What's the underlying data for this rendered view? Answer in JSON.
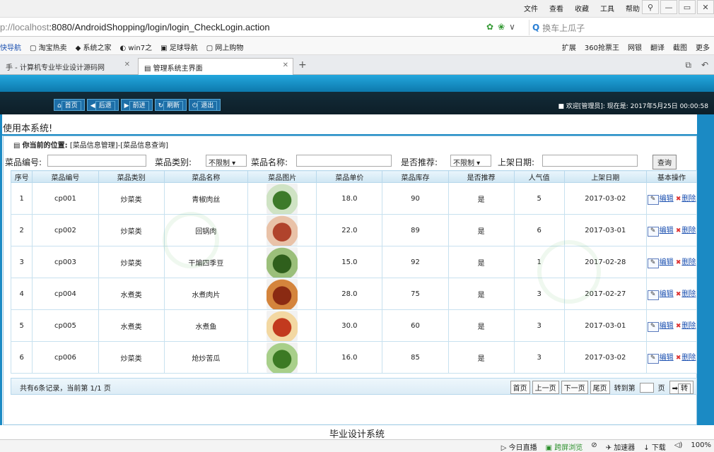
{
  "browser": {
    "menus": [
      "文件",
      "查看",
      "收藏",
      "工具",
      "帮助"
    ],
    "url_host": "p://localhost",
    "url_rest": ":8080/AndroidShopping/login/login_CheckLogin.action",
    "search_placeholder": "换车上瓜子",
    "bookmarks": [
      "快导航",
      "淘宝热卖",
      "系统之家",
      "win7之",
      "足球导航",
      "网上购物"
    ],
    "toolbar_right": [
      "扩展",
      "360抢票王",
      "网银",
      "翻译",
      "截图",
      "更多"
    ],
    "tab1": "手 - 计算机专业毕业设计源码网",
    "tab2": "管理系统主界面"
  },
  "app": {
    "nav": [
      "首页",
      "后退",
      "前进",
      "刷新",
      "退出"
    ],
    "welcome": "欢迎[管理员]:  现在是: 2017年5月25日  00:00:58",
    "notice": "使用本系统!",
    "position_label": "你当前的位置:",
    "position_path": "[菜品信息管理]-[菜品信息查询]"
  },
  "filters": {
    "code_label": "菜品编号:",
    "type_label": "菜品类别:",
    "type_value": "不限制",
    "name_label": "菜品名称:",
    "rec_label": "是否推荐:",
    "rec_value": "不限制",
    "date_label": "上架日期:",
    "query": "查询"
  },
  "table": {
    "headers": [
      "序号",
      "菜品编号",
      "菜品类别",
      "菜品名称",
      "菜品图片",
      "菜品单价",
      "菜品库存",
      "是否推荐",
      "人气值",
      "上架日期",
      "基本操作"
    ],
    "rows": [
      {
        "no": "1",
        "code": "cp001",
        "type": "炒菜类",
        "name": "青椒肉丝",
        "price": "18.0",
        "stock": "90",
        "rec": "是",
        "pop": "5",
        "date": "2017-03-02",
        "c1": "#cfe3c4",
        "c2": "#3d7a2a"
      },
      {
        "no": "2",
        "code": "cp002",
        "type": "炒菜类",
        "name": "回锅肉",
        "price": "22.0",
        "stock": "89",
        "rec": "是",
        "pop": "6",
        "date": "2017-03-01",
        "c1": "#e9c2a8",
        "c2": "#b0432c"
      },
      {
        "no": "3",
        "code": "cp003",
        "type": "炒菜类",
        "name": "干煸四季豆",
        "price": "15.0",
        "stock": "92",
        "rec": "是",
        "pop": "1",
        "date": "2017-02-28",
        "c1": "#9bbf7a",
        "c2": "#2f5f1c"
      },
      {
        "no": "4",
        "code": "cp004",
        "type": "水煮类",
        "name": "水煮肉片",
        "price": "28.0",
        "stock": "75",
        "rec": "是",
        "pop": "3",
        "date": "2017-02-27",
        "c1": "#d4843c",
        "c2": "#8a2a12"
      },
      {
        "no": "5",
        "code": "cp005",
        "type": "水煮类",
        "name": "水煮鱼",
        "price": "30.0",
        "stock": "60",
        "rec": "是",
        "pop": "3",
        "date": "2017-03-01",
        "c1": "#f3d8a2",
        "c2": "#c23a1e"
      },
      {
        "no": "6",
        "code": "cp006",
        "type": "炒菜类",
        "name": "炝炒苦瓜",
        "price": "16.0",
        "stock": "85",
        "rec": "是",
        "pop": "3",
        "date": "2017-03-02",
        "c1": "#a8cf8a",
        "c2": "#3c7a24"
      }
    ],
    "edit": "编辑",
    "delete": "删除"
  },
  "pager": {
    "total": "共有6条记录，当前第 1/1 页",
    "first": "首页",
    "prev": "上一页",
    "next": "下一页",
    "last": "尾页",
    "goto": "转到第",
    "page": "页",
    "go": "转"
  },
  "footer": "毕业设计系统",
  "status": {
    "items": [
      "今日直播",
      "跨屏浏览",
      "加速器",
      "下载"
    ],
    "zoom": "100%"
  }
}
